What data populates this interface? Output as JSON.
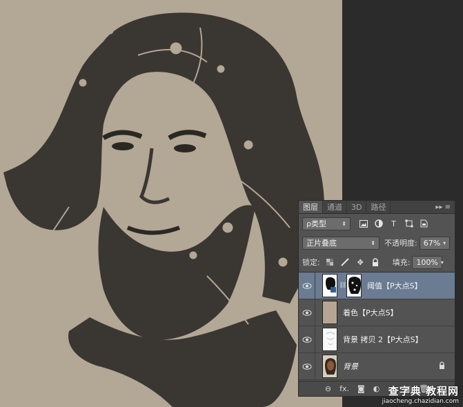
{
  "panel": {
    "tabs": [
      "图层",
      "通道",
      "3D",
      "路径"
    ],
    "active_tab": "图层",
    "filter": {
      "kind_label": "ρ类型"
    },
    "blend_mode": "正片叠底",
    "opacity_label": "不透明度:",
    "opacity_value": "67%",
    "lock_label": "锁定:",
    "fill_label": "填充:",
    "fill_value": "100%",
    "layers": [
      {
        "name": "阈值【P大点S】",
        "selected": true,
        "visible": true,
        "thumb": "threshold-icon",
        "has_mask": true
      },
      {
        "name": "着色【P大点S】",
        "selected": false,
        "visible": true,
        "thumb": "solid-fill",
        "fill_color": "#b6a593"
      },
      {
        "name": "背景 拷贝 2【P大点S】",
        "selected": false,
        "visible": true,
        "thumb": "sketch"
      },
      {
        "name": "背景",
        "selected": false,
        "visible": true,
        "thumb": "portrait",
        "locked": true
      }
    ],
    "footer_icons": [
      "link-icon",
      "fx-icon",
      "mask-icon",
      "adjustment-icon",
      "folder-icon",
      "new-layer-icon",
      "trash-icon"
    ],
    "footer_fx": "fx."
  },
  "watermark": {
    "main": "查字典 教程网",
    "sub": "jiaocheng.chazidian.com"
  },
  "colors": {
    "canvas_bg": "#b3a795",
    "ink": "#3a3631",
    "workspace": "#2b2b2b",
    "panel_bg": "#535353",
    "selected_row": "#6a7b92"
  }
}
